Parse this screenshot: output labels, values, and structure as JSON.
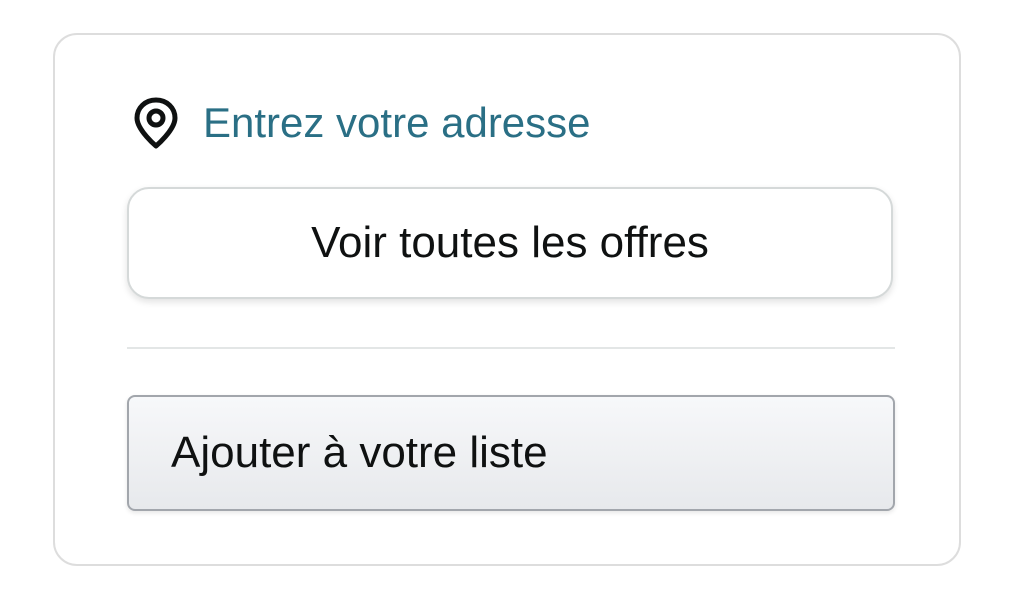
{
  "location": {
    "icon": "location-pin-icon",
    "link_text": "Entrez votre adresse",
    "link_color": "#2a6f85"
  },
  "offers_button": {
    "label": "Voir toutes les offres"
  },
  "list_button": {
    "label": "Ajouter à votre liste"
  }
}
